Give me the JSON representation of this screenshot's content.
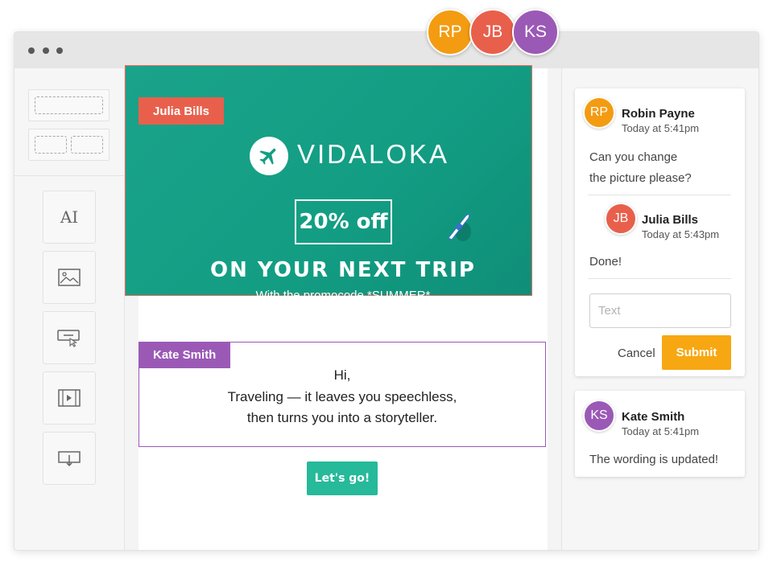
{
  "collaborators": [
    {
      "initials": "RP",
      "color": "#f39c12"
    },
    {
      "initials": "JB",
      "color": "#e8604c"
    },
    {
      "initials": "KS",
      "color": "#9b59b6"
    }
  ],
  "toolbar": {
    "tools": [
      "text-tool-icon",
      "image-icon",
      "button-icon",
      "video-icon",
      "banner-icon"
    ],
    "text_tool_label": "AI"
  },
  "editor": {
    "banner": {
      "editor_tag": "Julia Bills",
      "brand": "VIDALOKA",
      "discount": "20% off",
      "headline": "ON YOUR NEXT TRIP",
      "subline": "With the promocode *SUMMER*"
    },
    "text_block": {
      "editor_tag": "Kate Smith",
      "lines": [
        "Hi,",
        "Traveling — it leaves you speechless,",
        "then turns you into a storyteller."
      ]
    },
    "cta_label": "Let's go!"
  },
  "comments": {
    "thread1": {
      "author": {
        "initials": "RP",
        "name": "Robin Payne",
        "time": "Today at 5:41pm"
      },
      "text_line1": "Can you change",
      "text_line2": "the picture please?",
      "reply": {
        "initials": "JB",
        "name": "Julia Bills",
        "time": "Today at 5:43pm",
        "text": "Done!"
      },
      "input_placeholder": "Text",
      "cancel_label": "Cancel",
      "submit_label": "Submit"
    },
    "thread2": {
      "author": {
        "initials": "KS",
        "name": "Kate Smith",
        "time": "Today at 5:41pm"
      },
      "text": "The wording is updated!"
    }
  },
  "colors": {
    "banner_green": "#139e84",
    "cta_green": "#26b99a",
    "submit_orange": "#f7a711",
    "julia_red": "#e8604c",
    "kate_purple": "#9b59b6",
    "robin_orange": "#f39c12"
  }
}
